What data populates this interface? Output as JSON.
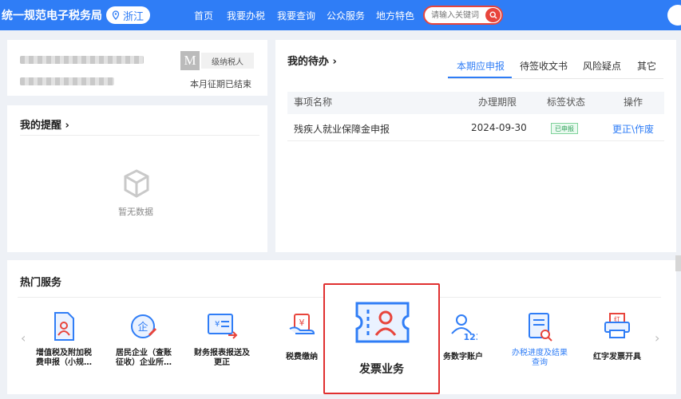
{
  "header": {
    "brand": "统一规范电子税务局",
    "location": "浙江",
    "nav": [
      "首页",
      "我要办税",
      "我要查询",
      "公众服务",
      "地方特色"
    ],
    "search_placeholder": "请输入关键词"
  },
  "taxpayer": {
    "badge": "M",
    "rank": "级纳税人",
    "period_status": "本月征期已结束"
  },
  "reminders": {
    "title": "我的提醒 ›",
    "empty_text": "暂无数据"
  },
  "todo": {
    "title": "我的待办 ›",
    "tabs": [
      "本期应申报",
      "待签收文书",
      "风险疑点",
      "其它"
    ],
    "columns": [
      "事项名称",
      "办理期限",
      "标签状态",
      "操作"
    ],
    "rows": [
      {
        "name": "残疾人就业保障金申报",
        "deadline": "2024-09-30",
        "status": "已申报",
        "action": "更正\\作废"
      }
    ]
  },
  "hot_services": {
    "title": "热门服务",
    "prev": "‹",
    "next": "›",
    "items": [
      {
        "line1": "增值税及附加税",
        "line2": "费申报（小规…",
        "icon": "vat-report-icon"
      },
      {
        "line1": "居民企业（查账",
        "line2": "征收）企业所…",
        "icon": "enterprise-tax-icon"
      },
      {
        "line1": "财务报表报送及",
        "line2": "更正",
        "icon": "financial-report-icon"
      },
      {
        "line1": "税费缴纳",
        "line2": "",
        "icon": "tax-payment-icon"
      },
      {
        "line1": "发票业务",
        "line2": "",
        "icon": "invoice-icon"
      },
      {
        "line1": "务数字账户",
        "line2": "",
        "icon": "digital-account-icon"
      },
      {
        "line1": "办税进度及结果",
        "line2": "查询",
        "icon": "progress-query-icon"
      },
      {
        "line1": "红字发票开具",
        "line2": "",
        "icon": "red-invoice-icon"
      }
    ]
  },
  "colors": {
    "primary": "#2f7df6",
    "danger": "#e03030",
    "success": "#33a35c"
  }
}
